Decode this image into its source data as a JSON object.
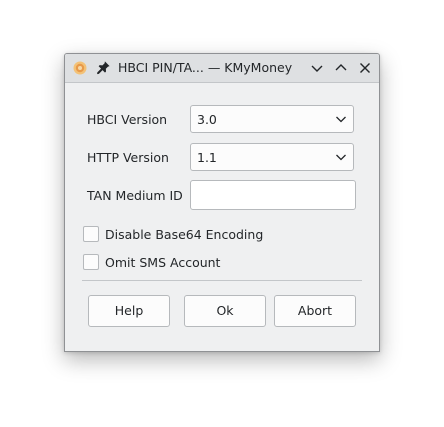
{
  "window": {
    "title": "HBCI PIN/TA... — KMyMoney",
    "app_icon": "kmymoney-app-icon",
    "pin_icon": "pin-icon",
    "controls": [
      "minimize-icon",
      "maximize-icon",
      "close-icon"
    ]
  },
  "form": {
    "hbci_version_label": "HBCI Version",
    "hbci_version_value": "3.0",
    "http_version_label": "HTTP Version",
    "http_version_value": "1.1",
    "tan_medium_label": "TAN Medium ID",
    "tan_medium_value": ""
  },
  "checkboxes": {
    "disable_base64_label": "Disable Base64 Encoding",
    "disable_base64_checked": false,
    "omit_sms_label": "Omit SMS Account",
    "omit_sms_checked": false
  },
  "buttons": {
    "help": "Help",
    "ok": "Ok",
    "abort": "Abort"
  },
  "colors": {
    "window_bg": "#eff0f1",
    "titlebar_bg": "#dee0e2",
    "text": "#232629",
    "border": "#b6b9bc"
  }
}
